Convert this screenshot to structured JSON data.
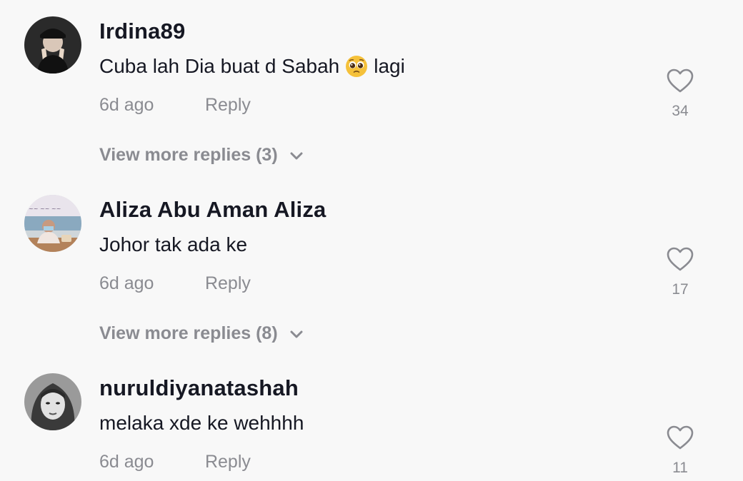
{
  "comments": [
    {
      "username": "Irdina89",
      "text_before": "Cuba lah Dia buat d Sabah",
      "emoji": "pleading-face-emoji",
      "text_after": "lagi",
      "time": "6d ago",
      "reply_label": "Reply",
      "likes": "34",
      "more_replies": "View more replies (3)"
    },
    {
      "username": "Aliza Abu Aman Aliza",
      "text": "Johor tak ada ke",
      "time": "6d ago",
      "reply_label": "Reply",
      "likes": "17",
      "more_replies": "View more replies (8)"
    },
    {
      "username": "nuruldiyanatashah",
      "text": "melaka xde ke wehhhh",
      "time": "6d ago",
      "reply_label": "Reply",
      "likes": "11"
    }
  ],
  "colors": {
    "background": "#f8f8f8",
    "primary_text": "#161823",
    "secondary_text": "#8a8b91"
  }
}
